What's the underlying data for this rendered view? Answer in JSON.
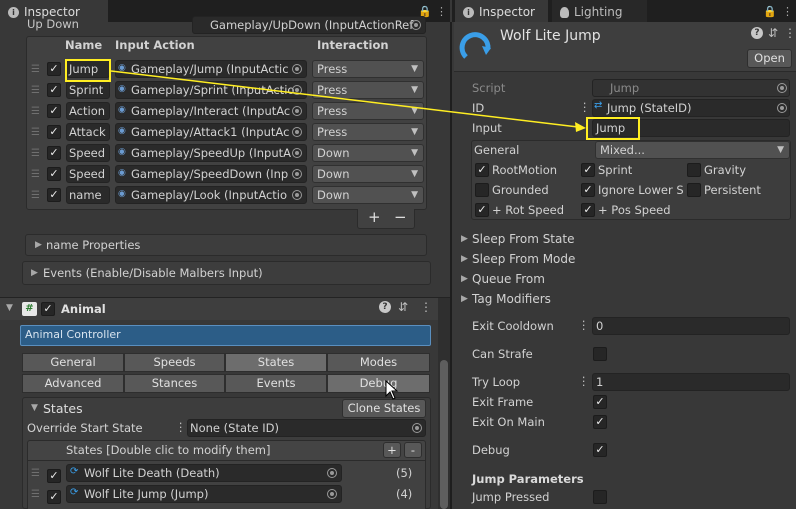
{
  "left_tab": {
    "title": "Inspector"
  },
  "right_tabs": {
    "inspector": "Inspector",
    "lighting": "Lighting"
  },
  "left": {
    "updown_label": "Up Down",
    "updown_value": "Gameplay/UpDown (InputActionRef",
    "table_headers": {
      "name": "Name",
      "action": "Input Action",
      "interaction": "Interaction"
    },
    "rows": [
      {
        "name": "Jump",
        "action": "Gameplay/Jump (InputActic",
        "interaction": "Press"
      },
      {
        "name": "Sprint",
        "action": "Gameplay/Sprint (InputActio",
        "interaction": "Press"
      },
      {
        "name": "Action",
        "action": "Gameplay/Interact (InputAc",
        "interaction": "Press"
      },
      {
        "name": "Attack",
        "action": "Gameplay/Attack1 (InputAc",
        "interaction": "Press"
      },
      {
        "name": "Speed",
        "action": "Gameplay/SpeedUp (InputA",
        "interaction": "Down"
      },
      {
        "name": "Speed",
        "action": "Gameplay/SpeedDown (Inp",
        "interaction": "Down"
      },
      {
        "name": "name",
        "action": "Gameplay/Look (InputActio",
        "interaction": "Down"
      }
    ],
    "plus": "+",
    "minus": "−",
    "name_properties": "name Properties",
    "events": "Events (Enable/Disable Malbers Input)",
    "animal_title": "Animal",
    "animal_controller": "Animal Controller",
    "tabs_row1": [
      "General",
      "Speeds",
      "States",
      "Modes"
    ],
    "tabs_row2": [
      "Advanced",
      "Stances",
      "Events",
      "Debug"
    ],
    "states_title": "States",
    "clone_states": "Clone States",
    "override_label": "Override Start State",
    "override_value": "None (State ID)",
    "states_list_header": "States [Double clic to modify them]",
    "list_plus": "+",
    "list_minus": "-",
    "state_items": [
      {
        "label": "Wolf Lite Death (Death)",
        "priority": "(5)"
      },
      {
        "label": "Wolf Lite Jump (Jump)",
        "priority": "(4)"
      }
    ]
  },
  "right": {
    "title": "Wolf Lite Jump",
    "open_button": "Open",
    "script_label": "Script",
    "script_value": "Jump",
    "id_label": "ID",
    "id_value": "Jump (StateID)",
    "input_label": "Input",
    "input_value": "Jump",
    "general_label": "General",
    "general_value": "Mixed...",
    "flags": [
      {
        "label": "RootMotion",
        "checked": true
      },
      {
        "label": "Sprint",
        "checked": true
      },
      {
        "label": "Gravity",
        "checked": false
      },
      {
        "label": "Grounded",
        "checked": false
      },
      {
        "label": "Ignore Lower S",
        "checked": true
      },
      {
        "label": "Persistent",
        "checked": false
      },
      {
        "label": "+ Rot Speed",
        "checked": true
      },
      {
        "label": "+ Pos Speed",
        "checked": true
      }
    ],
    "foldouts": [
      "Sleep From State",
      "Sleep From Mode",
      "Queue From",
      "Tag Modifiers"
    ],
    "exit_cooldown_label": "Exit Cooldown",
    "exit_cooldown_value": "0",
    "can_strafe_label": "Can Strafe",
    "try_loop_label": "Try Loop",
    "try_loop_value": "1",
    "exit_frame_label": "Exit Frame",
    "exit_on_main_label": "Exit On Main",
    "debug_label": "Debug",
    "jump_params_label": "Jump Parameters",
    "jump_pressed_label": "Jump Pressed"
  },
  "colors": {
    "highlight": "#ffee22",
    "accent_blue": "#3a9ee8",
    "selection": "#2c5d87"
  }
}
